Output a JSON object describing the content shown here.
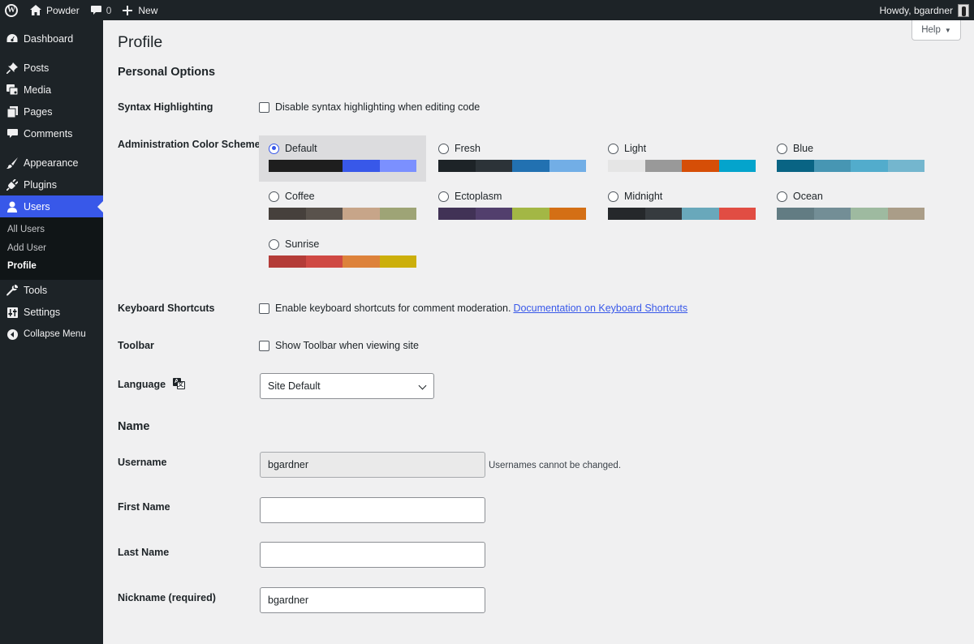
{
  "adminbar": {
    "site_name": "Powder",
    "comments_count": "0",
    "new_label": "New",
    "howdy": "Howdy, bgardner",
    "icons": {
      "logo": "wordpress-logo-icon",
      "home": "home-icon",
      "comments": "comment-bubble-icon",
      "new": "plus-icon"
    }
  },
  "sidebar": {
    "items": [
      {
        "label": "Dashboard",
        "icon": "dashboard-icon"
      },
      {
        "label": "Posts",
        "icon": "pin-icon"
      },
      {
        "label": "Media",
        "icon": "media-icon"
      },
      {
        "label": "Pages",
        "icon": "pages-icon"
      },
      {
        "label": "Comments",
        "icon": "comments-icon"
      },
      {
        "label": "Appearance",
        "icon": "brush-icon"
      },
      {
        "label": "Plugins",
        "icon": "plug-icon"
      },
      {
        "label": "Users",
        "icon": "user-icon"
      },
      {
        "label": "Tools",
        "icon": "wrench-icon"
      },
      {
        "label": "Settings",
        "icon": "settings-icon"
      },
      {
        "label": "Collapse Menu",
        "icon": "collapse-icon"
      }
    ],
    "users_submenu": [
      "All Users",
      "Add User",
      "Profile"
    ],
    "accent": "#3858e9"
  },
  "help": {
    "label": "Help"
  },
  "page": {
    "title": "Profile"
  },
  "personal_options": {
    "title": "Personal Options",
    "syntax": {
      "label": "Syntax Highlighting",
      "checkbox_text": "Disable syntax highlighting when editing code"
    },
    "color_scheme": {
      "label": "Administration Color Scheme",
      "selected": "Default",
      "schemes": [
        {
          "name": "Default",
          "colors": [
            "#1e1e1e",
            "#1e1e1e",
            "#3858e9",
            "#7b90ff"
          ]
        },
        {
          "name": "Fresh",
          "colors": [
            "#1d2327",
            "#2c3338",
            "#2271b1",
            "#72aee6"
          ]
        },
        {
          "name": "Light",
          "colors": [
            "#e5e5e5",
            "#999999",
            "#d64e07",
            "#04a4cc"
          ]
        },
        {
          "name": "Blue",
          "colors": [
            "#096484",
            "#4796b3",
            "#52accc",
            "#74b6ce"
          ]
        },
        {
          "name": "Coffee",
          "colors": [
            "#46403c",
            "#59524c",
            "#c7a589",
            "#9ea476"
          ]
        },
        {
          "name": "Ectoplasm",
          "colors": [
            "#413256",
            "#523f6d",
            "#a3b745",
            "#d46f15"
          ]
        },
        {
          "name": "Midnight",
          "colors": [
            "#25282b",
            "#363b3f",
            "#69a8bb",
            "#e14d43"
          ]
        },
        {
          "name": "Ocean",
          "colors": [
            "#627c83",
            "#738e96",
            "#9ebaa0",
            "#aa9d88"
          ]
        },
        {
          "name": "Sunrise",
          "colors": [
            "#b43c38",
            "#cf4944",
            "#dd823b",
            "#ccaf0b"
          ]
        }
      ]
    },
    "keyboard": {
      "label": "Keyboard Shortcuts",
      "checkbox_text": "Enable keyboard shortcuts for comment moderation.",
      "link_text": "Documentation on Keyboard Shortcuts"
    },
    "toolbar": {
      "label": "Toolbar",
      "checkbox_text": "Show Toolbar when viewing site"
    },
    "language": {
      "label": "Language",
      "value": "Site Default",
      "icon": "translation-icon"
    }
  },
  "name_section": {
    "title": "Name",
    "username": {
      "label": "Username",
      "value": "bgardner",
      "note": "Usernames cannot be changed."
    },
    "first_name": {
      "label": "First Name",
      "value": ""
    },
    "last_name": {
      "label": "Last Name",
      "value": ""
    },
    "nickname": {
      "label": "Nickname (required)",
      "value": "bgardner"
    }
  }
}
